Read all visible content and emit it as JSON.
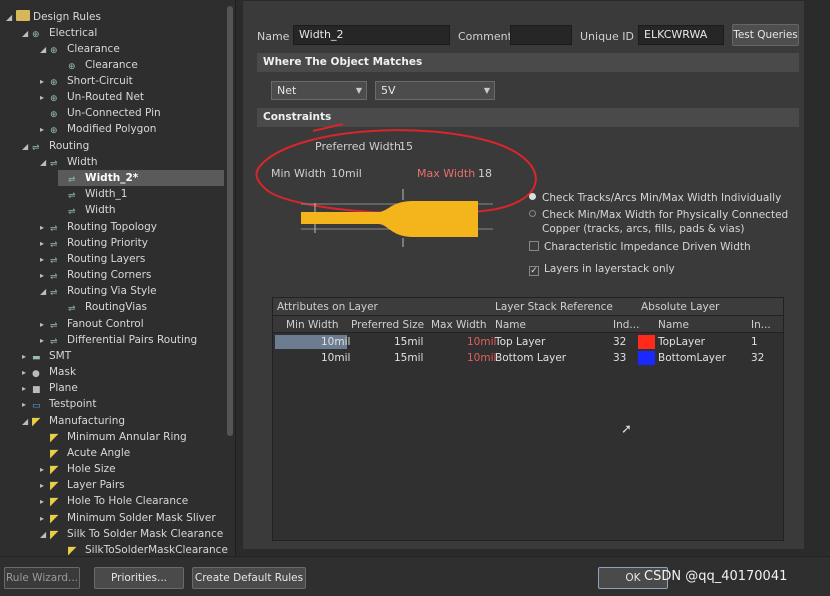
{
  "tree": {
    "items": [
      {
        "label": "Design Rules",
        "icon": "folder-icon",
        "arrow": "◢"
      },
      {
        "label": "Electrical",
        "icon": "rule-icon",
        "arrow": "◢"
      },
      {
        "label": "Clearance",
        "icon": "rule-icon",
        "arrow": "◢"
      },
      {
        "label": "Clearance",
        "icon": "rule-icon",
        "arrow": ""
      },
      {
        "label": "Short-Circuit",
        "icon": "rule-icon",
        "arrow": "▸"
      },
      {
        "label": "Un-Routed Net",
        "icon": "rule-icon",
        "arrow": "▸"
      },
      {
        "label": "Un-Connected Pin",
        "icon": "rule-icon",
        "arrow": ""
      },
      {
        "label": "Modified Polygon",
        "icon": "rule-icon",
        "arrow": "▸"
      },
      {
        "label": "Routing",
        "icon": "routing-icon",
        "arrow": "◢"
      },
      {
        "label": "Width",
        "icon": "routing-icon",
        "arrow": "◢"
      },
      {
        "label": "Width_2*",
        "icon": "routing-icon",
        "arrow": ""
      },
      {
        "label": "Width_1",
        "icon": "routing-icon",
        "arrow": ""
      },
      {
        "label": "Width",
        "icon": "routing-icon",
        "arrow": ""
      },
      {
        "label": "Routing Topology",
        "icon": "routing-icon",
        "arrow": "▸"
      },
      {
        "label": "Routing Priority",
        "icon": "routing-icon",
        "arrow": "▸"
      },
      {
        "label": "Routing Layers",
        "icon": "routing-icon",
        "arrow": "▸"
      },
      {
        "label": "Routing Corners",
        "icon": "routing-icon",
        "arrow": "▸"
      },
      {
        "label": "Routing Via Style",
        "icon": "routing-icon",
        "arrow": "◢"
      },
      {
        "label": "RoutingVias",
        "icon": "routing-icon",
        "arrow": ""
      },
      {
        "label": "Fanout Control",
        "icon": "routing-icon",
        "arrow": "▸"
      },
      {
        "label": "Differential Pairs Routing",
        "icon": "routing-icon",
        "arrow": "▸"
      },
      {
        "label": "SMT",
        "icon": "smt-icon",
        "arrow": "▸"
      },
      {
        "label": "Mask",
        "icon": "mask-icon",
        "arrow": "▸"
      },
      {
        "label": "Plane",
        "icon": "plane-icon",
        "arrow": "▸"
      },
      {
        "label": "Testpoint",
        "icon": "testpoint-icon",
        "arrow": "▸"
      },
      {
        "label": "Manufacturing",
        "icon": "manufacturing-icon",
        "arrow": "◢"
      },
      {
        "label": "Minimum Annular Ring",
        "icon": "manufacturing-icon",
        "arrow": ""
      },
      {
        "label": "Acute Angle",
        "icon": "manufacturing-icon",
        "arrow": ""
      },
      {
        "label": "Hole Size",
        "icon": "manufacturing-icon",
        "arrow": "▸"
      },
      {
        "label": "Layer Pairs",
        "icon": "manufacturing-icon",
        "arrow": "▸"
      },
      {
        "label": "Hole To Hole Clearance",
        "icon": "manufacturing-icon",
        "arrow": "▸"
      },
      {
        "label": "Minimum Solder Mask Sliver",
        "icon": "manufacturing-icon",
        "arrow": "▸"
      },
      {
        "label": "Silk To Solder Mask Clearance",
        "icon": "manufacturing-icon",
        "arrow": "◢"
      },
      {
        "label": "SilkToSolderMaskClearance",
        "icon": "manufacturing-icon",
        "arrow": ""
      }
    ]
  },
  "header": {
    "name_label": "Name",
    "name_value": "Width_2",
    "comment_label": "Comment",
    "comment_value": "",
    "uid_label": "Unique ID",
    "uid_value": "ELKCWRWA",
    "test_queries": "Test Queries"
  },
  "match": {
    "title": "Where The Object Matches",
    "scope": "Net",
    "net": "5V"
  },
  "constraints": {
    "title": "Constraints",
    "preferred_label": "Preferred Width",
    "preferred_value": "15",
    "min_label": "Min Width",
    "min_value": "10mil",
    "max_label": "Max Width",
    "max_value": "18",
    "opt1": "Check Tracks/Arcs Min/Max Width Individually",
    "opt2a": "Check Min/Max Width for Physically Connected",
    "opt2b": "Copper (tracks, arcs, fills, pads & vias)",
    "opt3": "Characteristic Impedance Driven Width",
    "opt4": "Layers in layerstack only"
  },
  "grid": {
    "group1": "Attributes on Layer",
    "group2": "Layer Stack Reference",
    "group3": "Absolute Layer",
    "cols": [
      "Min Width",
      "Preferred Size",
      "Max Width",
      "Name",
      "Ind...",
      "Name",
      "In..."
    ],
    "rows": [
      {
        "min": "10mil",
        "pref": "15mil",
        "max": "10mil",
        "name": "Top Layer",
        "ind": "32",
        "color": "#ff2a1a",
        "abs": "TopLayer",
        "in": "1"
      },
      {
        "min": "10mil",
        "pref": "15mil",
        "max": "10mil",
        "name": "Bottom Layer",
        "ind": "33",
        "color": "#1a2aff",
        "abs": "BottomLayer",
        "in": "32"
      }
    ]
  },
  "footer": {
    "rule_wizard": "Rule Wizard...",
    "priorities": "Priorities...",
    "create_default": "Create Default Rules",
    "ok": "OK",
    "watermark": "CSDN @qq_40170041"
  }
}
